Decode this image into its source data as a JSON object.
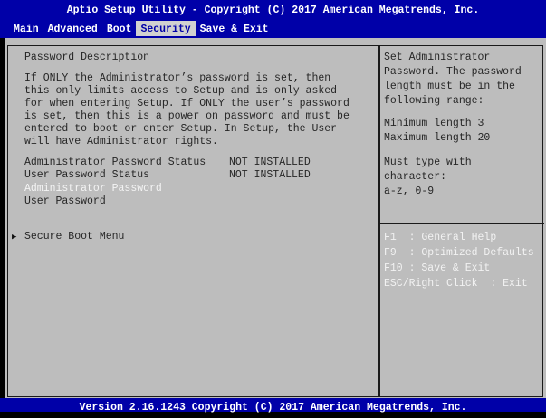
{
  "header": {
    "title": "Aptio Setup Utility - Copyright (C) 2017 American Megatrends, Inc.",
    "tabs": [
      "Main",
      "Advanced",
      "Boot",
      "Security",
      "Save & Exit"
    ],
    "active_tab": "Security"
  },
  "left": {
    "section_title": "Password Description",
    "description": [
      "If ONLY the Administrator’s password is set, then",
      "this only limits access to Setup and is only asked",
      "for when entering Setup. If ONLY the user’s password",
      "is set, then this is a power on password and must be",
      "entered to boot or enter Setup. In Setup, the User",
      "will have Administrator rights."
    ],
    "status_rows": [
      {
        "label": "Administrator Password Status",
        "value": "NOT INSTALLED"
      },
      {
        "label": "User Password Status",
        "value": "NOT INSTALLED"
      }
    ],
    "items": [
      {
        "label": "Administrator Password",
        "selected": true
      },
      {
        "label": "User Password",
        "selected": false
      }
    ],
    "submenu": {
      "label": "Secure Boot Menu",
      "marker": "▶"
    }
  },
  "right": {
    "help": [
      "Set Administrator",
      "Password. The password",
      "length must be in the",
      "following range:",
      "",
      "Minimum length 3",
      "Maximum length 20",
      "",
      "Must type with",
      "character:",
      "a-z, 0-9"
    ],
    "keys": [
      "F1  : General Help",
      "F9  : Optimized Defaults",
      "F10 : Save & Exit",
      "ESC/Right Click  : Exit"
    ]
  },
  "footer": {
    "text": "Version 2.16.1243 Copyright (C) 2017 American Megatrends, Inc."
  },
  "colors": {
    "header_bg": "#0000a8",
    "panel_bg": "#bdbdbd",
    "highlight_text": "#f4f4f4"
  }
}
